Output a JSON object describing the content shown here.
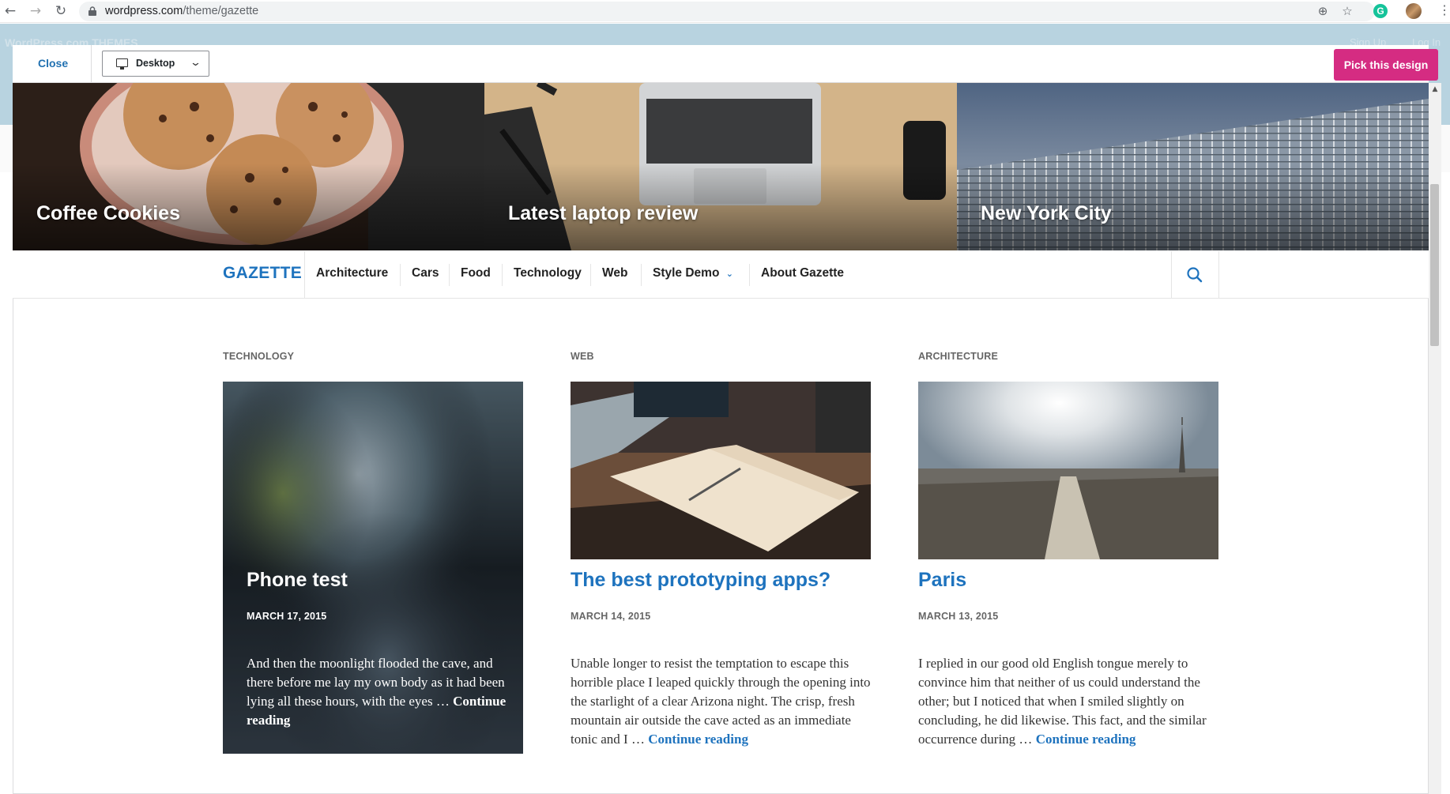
{
  "browser": {
    "url_domain": "wordpress.com",
    "url_path": "/theme/gazette",
    "back_icon": "arrow-back-icon",
    "forward_icon": "arrow-forward-icon",
    "reload_icon": "reload-icon"
  },
  "background_page": {
    "logo_text": "WordPress.com THEMES",
    "signup": "Sign Up",
    "login": "Log In"
  },
  "toolbar": {
    "close_label": "Close",
    "device_label": "Desktop",
    "pick_label": "Pick this design",
    "pick_color": "#d52c82"
  },
  "hero": [
    {
      "title": "Coffee Cookies"
    },
    {
      "title": "Latest laptop review"
    },
    {
      "title": "New York City"
    }
  ],
  "site": {
    "brand": "GAZETTE",
    "accent": "#1e73be",
    "nav": [
      "Architecture",
      "Cars",
      "Food",
      "Technology",
      "Web",
      "Style Demo",
      "About Gazette"
    ]
  },
  "posts": [
    {
      "category": "TECHNOLOGY",
      "title": "Phone test",
      "date": "MARCH 17, 2015",
      "excerpt": "And then the moonlight flooded the cave, and there before me lay my own body as it had been lying all these hours, with the eyes … ",
      "more": "Continue reading"
    },
    {
      "category": "WEB",
      "title": "The best prototyping apps?",
      "date": "MARCH 14, 2015",
      "excerpt": "Unable longer to resist the temptation to escape this horrible place I leaped quickly through the opening into the starlight of a clear Arizona night. The crisp, fresh mountain air outside the cave acted as an immediate tonic and I … ",
      "more": "Continue reading"
    },
    {
      "category": "ARCHITECTURE",
      "title": "Paris",
      "date": "MARCH 13, 2015",
      "excerpt": "I replied in our good old English tongue merely to convince him that neither of us could understand the other; but I noticed that when I smiled slightly on concluding, he did likewise. This fact, and the similar occurrence during … ",
      "more": "Continue reading"
    }
  ]
}
